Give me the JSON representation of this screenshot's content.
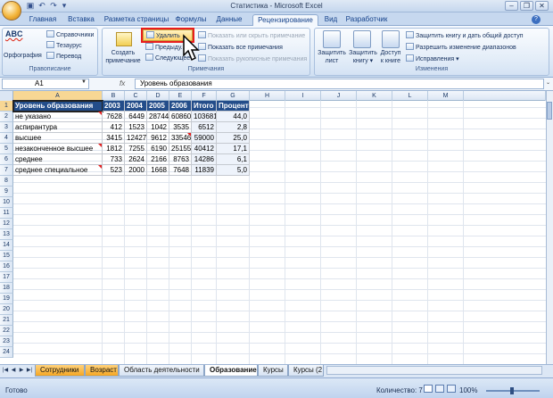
{
  "window": {
    "title": "Статистика - Microsoft Excel",
    "controls": [
      "–",
      "❐",
      "✕"
    ]
  },
  "ribbon_tabs": [
    "Главная",
    "Вставка",
    "Разметка страницы",
    "Формулы",
    "Данные",
    "Рецензирование",
    "Вид",
    "Разработчик"
  ],
  "active_tab": "Рецензирование",
  "ribbon": {
    "proofing": {
      "label": "Правописание",
      "spelling": "Орфография",
      "references": "Справочники",
      "thesaurus": "Тезаурус",
      "translate": "Перевод",
      "abc": "ABC"
    },
    "comments": {
      "label": "Примечания",
      "create": "Создать",
      "create2": "примечание",
      "delete": "Удалить",
      "previous": "Предыду...",
      "next": "Следующее",
      "show_hide": "Показать или скрыть примечание",
      "show_all": "Показать все примечания",
      "show_ink": "Показать рукописные примечания"
    },
    "changes": {
      "label": "Изменения",
      "protect_sheet": "Защитить",
      "protect_sheet2": "лист",
      "protect_book": "Защитить",
      "protect_book2": "книгу ▾",
      "share_book": "Доступ",
      "share_book2": "к книге",
      "protect_share": "Защитить книгу и дать общий доступ",
      "allow_ranges": "Разрешить изменение диапазонов",
      "track_changes": "Исправления ▾"
    }
  },
  "formula_bar": {
    "name_box": "A1",
    "fx": "fx",
    "content": "Уровень образования"
  },
  "columns": [
    "A",
    "B",
    "C",
    "D",
    "E",
    "F",
    "G",
    "H",
    "I",
    "J",
    "K",
    "L",
    "M"
  ],
  "rows": [
    "1",
    "2",
    "3",
    "4",
    "5",
    "6",
    "7",
    "8",
    "9",
    "10",
    "11",
    "12",
    "13",
    "14",
    "15",
    "16",
    "17",
    "18",
    "19",
    "20",
    "21",
    "22",
    "23",
    "24"
  ],
  "table": {
    "header": [
      "Уровень образования",
      "2003",
      "2004",
      "2005",
      "2006",
      "Итого",
      "Процент"
    ],
    "rows": [
      [
        "не указано",
        "7628",
        "6449",
        "28744",
        "60860",
        "103681",
        "44,0"
      ],
      [
        "аспирантура",
        "412",
        "1523",
        "1042",
        "3535",
        "6512",
        "2,8"
      ],
      [
        "высшее",
        "3415",
        "12427",
        "9612",
        "33546",
        "59000",
        "25,0"
      ],
      [
        "незаконченное высшее",
        "1812",
        "7255",
        "6190",
        "25155",
        "40412",
        "17,1"
      ],
      [
        "среднее",
        "733",
        "2624",
        "2166",
        "8763",
        "14286",
        "6,1"
      ],
      [
        "среднее специальное",
        "523",
        "2000",
        "1668",
        "7648",
        "11839",
        "5,0"
      ]
    ]
  },
  "sheet_tabs": [
    "Сотрудники",
    "Возраст",
    "Область деятельности",
    "Образование",
    "Курсы",
    "Курсы (2"
  ],
  "active_sheet": "Образование",
  "status_bar": {
    "ready": "Готово",
    "count": "Количество: 7",
    "zoom": "100%"
  },
  "colors": {
    "header_fill": "#234d8a",
    "ribbon": "#dce8f6",
    "highlight": "#e81e1e"
  }
}
